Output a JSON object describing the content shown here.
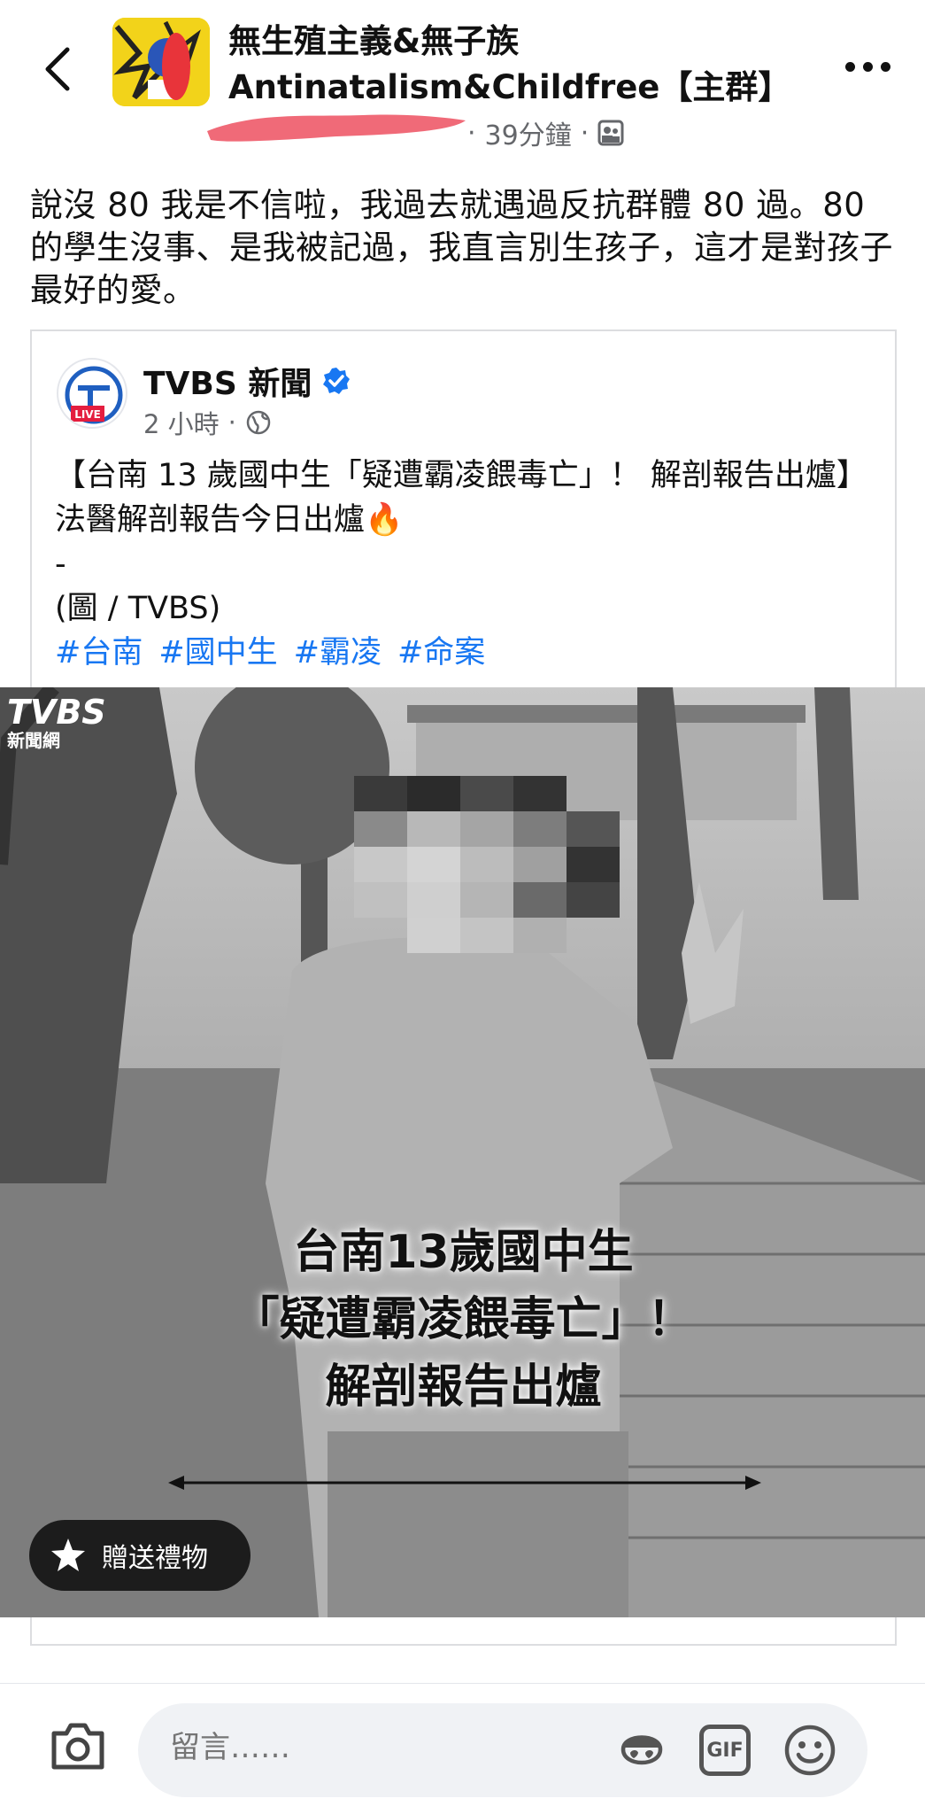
{
  "header": {
    "group_name_line1": "無生殖主義&無子族",
    "group_name_line2": "Antinatalism&Childfree【主群】",
    "time_ago": "39分鐘",
    "separator": "·"
  },
  "post": {
    "text": "說沒 80 我是不信啦，我過去就遇過反抗群體 80 過。80 的學生沒事、是我被記過，我直言別生孩子，這才是對孩子最好的愛。"
  },
  "shared_post": {
    "page_name": "TVBS 新聞",
    "live_badge": "LIVE",
    "time_ago": "2 小時",
    "separator": "·",
    "body_line1": "【台南 13 歲國中生「疑遭霸凌餵毒亡」！ 解剖報告出爐】法醫解剖報告今日出爐🔥",
    "body_line2": "-",
    "body_line3": "(圖 / TVBS)",
    "hashtags": [
      "#台南",
      "#國中生",
      "#霸凌",
      "#命案"
    ]
  },
  "image": {
    "watermark_line1": "TVBS",
    "watermark_line2": "新聞網",
    "caption_line1": "台南13歲國中生",
    "caption_line2": "「疑遭霸凌餵毒亡」！",
    "caption_line3": "解剖報告出爐",
    "gift_label": "贈送禮物"
  },
  "comment_bar": {
    "placeholder": "留言……",
    "gif_label": "GIF"
  },
  "colors": {
    "link": "#1877f2",
    "meta": "#65676b",
    "verified": "#1877f2",
    "live": "#e41e3f"
  }
}
